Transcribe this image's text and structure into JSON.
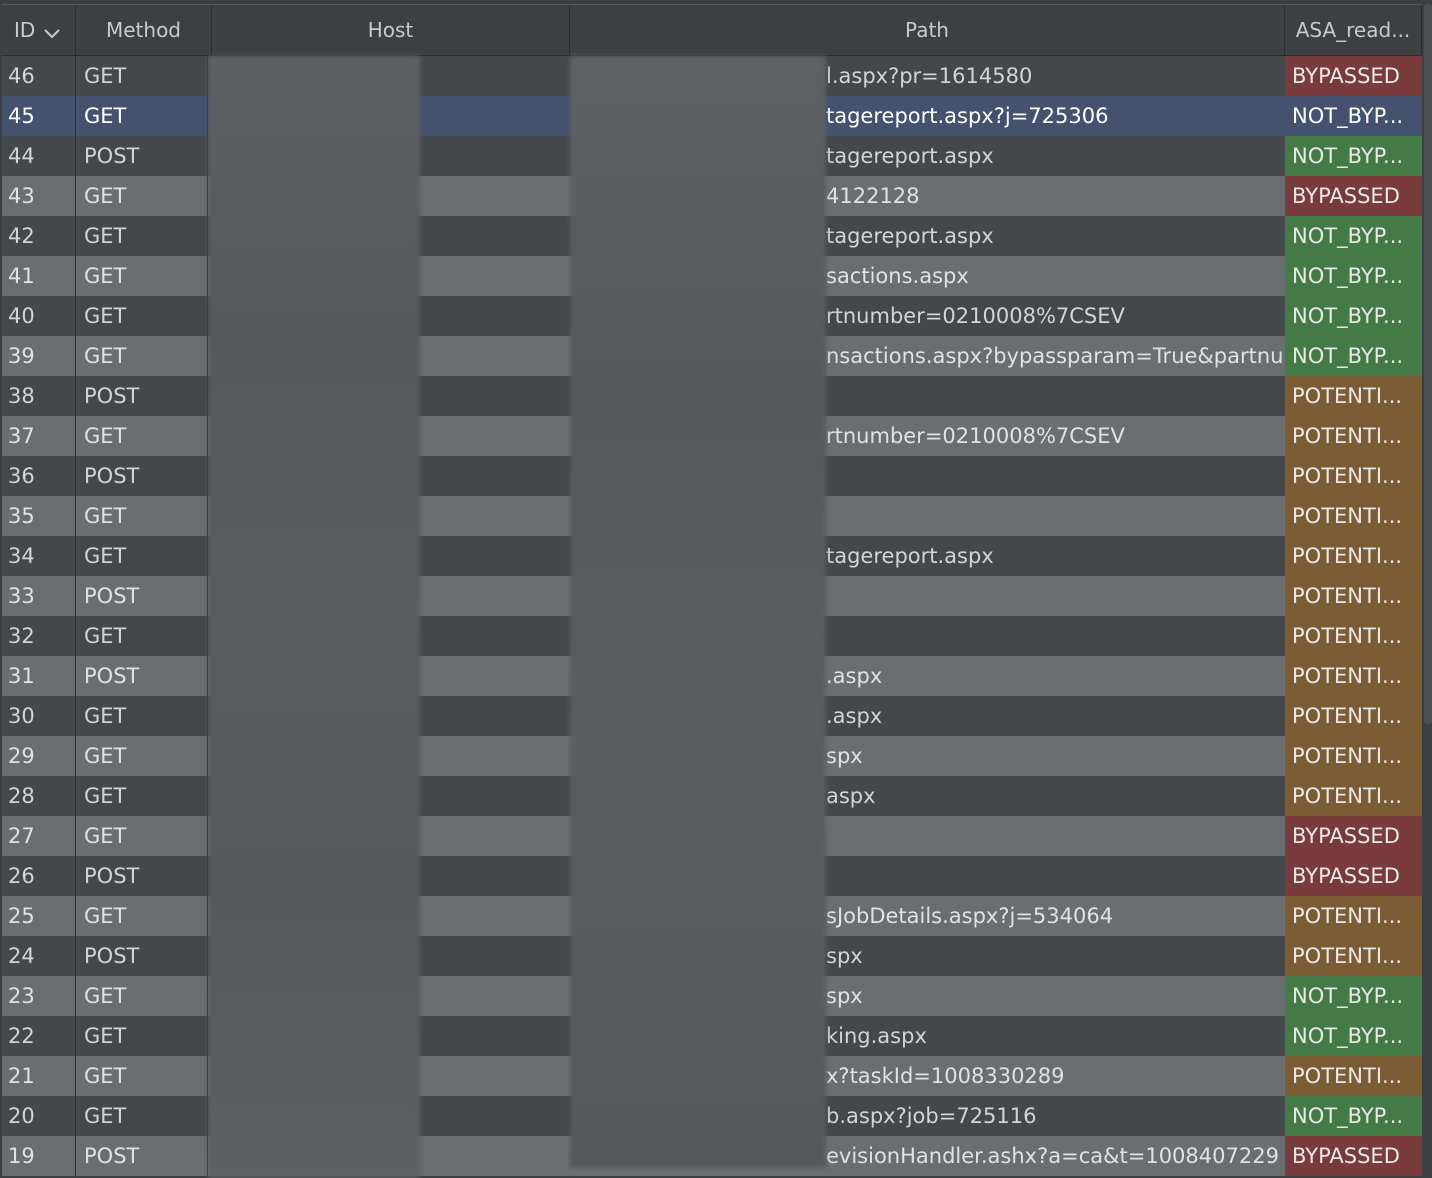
{
  "columns": {
    "id": "ID",
    "method": "Method",
    "host": "Host",
    "path": "Path",
    "asa": "ASA_read..."
  },
  "status_colors": {
    "BYPASSED": "#7a3b3d",
    "NOT_BYP...": "#447a45",
    "POTENTI...": "#7b5c34"
  },
  "selected_row_color": "#44526f",
  "rows": [
    {
      "id": "46",
      "method": "GET",
      "path": "l.aspx?pr=1614580",
      "asa": "BYPASSED"
    },
    {
      "id": "45",
      "method": "GET",
      "path": "tagereport.aspx?j=725306",
      "asa": "NOT_BYP..."
    },
    {
      "id": "44",
      "method": "POST",
      "path": "tagereport.aspx",
      "asa": "NOT_BYP..."
    },
    {
      "id": "43",
      "method": "GET",
      "path": "4122128",
      "asa": "BYPASSED"
    },
    {
      "id": "42",
      "method": "GET",
      "path": "tagereport.aspx",
      "asa": "NOT_BYP..."
    },
    {
      "id": "41",
      "method": "GET",
      "path": "sactions.aspx",
      "asa": "NOT_BYP..."
    },
    {
      "id": "40",
      "method": "GET",
      "path": "rtnumber=0210008%7CSEV",
      "asa": "NOT_BYP..."
    },
    {
      "id": "39",
      "method": "GET",
      "path": "nsactions.aspx?bypassparam=True&partnu...",
      "asa": "NOT_BYP..."
    },
    {
      "id": "38",
      "method": "POST",
      "path": "",
      "asa": "POTENTI..."
    },
    {
      "id": "37",
      "method": "GET",
      "path": "rtnumber=0210008%7CSEV",
      "asa": "POTENTI..."
    },
    {
      "id": "36",
      "method": "POST",
      "path": "",
      "asa": "POTENTI..."
    },
    {
      "id": "35",
      "method": "GET",
      "path": "",
      "asa": "POTENTI..."
    },
    {
      "id": "34",
      "method": "GET",
      "path": "tagereport.aspx",
      "asa": "POTENTI..."
    },
    {
      "id": "33",
      "method": "POST",
      "path": "",
      "asa": "POTENTI..."
    },
    {
      "id": "32",
      "method": "GET",
      "path": "",
      "asa": "POTENTI..."
    },
    {
      "id": "31",
      "method": "POST",
      "path": ".aspx",
      "asa": "POTENTI..."
    },
    {
      "id": "30",
      "method": "GET",
      "path": ".aspx",
      "asa": "POTENTI..."
    },
    {
      "id": "29",
      "method": "GET",
      "path": "spx",
      "asa": "POTENTI..."
    },
    {
      "id": "28",
      "method": "GET",
      "path": "aspx",
      "asa": "POTENTI..."
    },
    {
      "id": "27",
      "method": "GET",
      "path": "",
      "asa": "BYPASSED"
    },
    {
      "id": "26",
      "method": "POST",
      "path": "",
      "asa": "BYPASSED"
    },
    {
      "id": "25",
      "method": "GET",
      "path": "sJobDetails.aspx?j=534064",
      "asa": "POTENTI..."
    },
    {
      "id": "24",
      "method": "POST",
      "path": "spx",
      "asa": "POTENTI..."
    },
    {
      "id": "23",
      "method": "GET",
      "path": "spx",
      "asa": "NOT_BYP..."
    },
    {
      "id": "22",
      "method": "GET",
      "path": "king.aspx",
      "asa": "NOT_BYP..."
    },
    {
      "id": "21",
      "method": "GET",
      "path": "x?taskId=1008330289",
      "asa": "POTENTI..."
    },
    {
      "id": "20",
      "method": "GET",
      "path": "b.aspx?job=725116",
      "asa": "NOT_BYP..."
    },
    {
      "id": "19",
      "method": "POST",
      "path": "evisionHandler.ashx?a=ca&t=1008407229",
      "asa": "BYPASSED"
    }
  ],
  "selected_id": "45",
  "sort_icon": "chevron-down-icon"
}
